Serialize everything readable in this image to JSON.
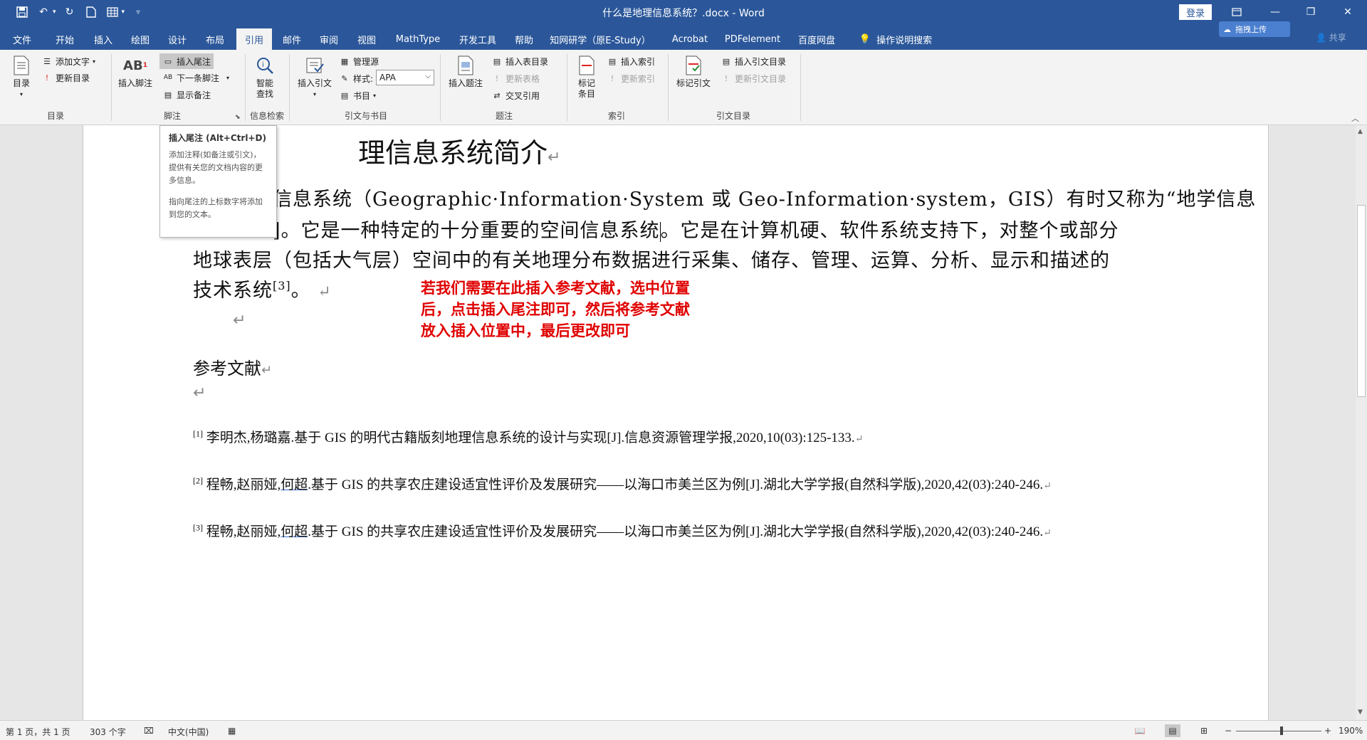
{
  "titlebar": {
    "title": "什么是地理信息系统？.docx  -  Word",
    "login": "登录",
    "icons": [
      "save-icon",
      "undo-icon",
      "redo-icon",
      "new-doc-icon",
      "table-icon",
      "customize-qat-icon"
    ]
  },
  "tabs": [
    "文件",
    "开始",
    "插入",
    "绘图",
    "设计",
    "布局",
    "引用",
    "邮件",
    "审阅",
    "视图",
    "MathType",
    "开发工具",
    "帮助",
    "知网研学（原E-Study）",
    "Acrobat",
    "PDFelement",
    "百度网盘",
    "操作说明搜索"
  ],
  "active_tab": "引用",
  "upload_label": "拖拽上传",
  "share_label": "共享",
  "ribbon": {
    "toc": {
      "big": "目录",
      "add_text": "添加文字",
      "update": "更新目录",
      "group": "目录"
    },
    "footnotes": {
      "insert_footnote": "插入脚注",
      "insert_endnote": "插入尾注",
      "next_footnote": "下一条脚注",
      "show_notes": "显示备注",
      "group": "脚注"
    },
    "research": {
      "smart_lookup_1": "智能",
      "smart_lookup_2": "查找",
      "group": "信息检索"
    },
    "citations": {
      "insert_citation": "插入引文",
      "manage_sources": "管理源",
      "style_label": "样式:",
      "style_value": "APA",
      "bibliography": "书目",
      "group": "引文与书目"
    },
    "captions": {
      "insert_caption": "插入题注",
      "insert_tof": "插入表目录",
      "update_table": "更新表格",
      "cross_ref": "交叉引用",
      "group": "题注"
    },
    "index": {
      "mark_entry_1": "标记",
      "mark_entry_2": "条目",
      "insert_index": "插入索引",
      "update_index": "更新索引",
      "group": "索引"
    },
    "toa": {
      "mark_citation": "标记引文",
      "insert_toa": "插入引文目录",
      "update_toa": "更新引文目录",
      "group": "引文目录"
    }
  },
  "tooltip": {
    "title": "插入尾注 (Alt+Ctrl+D)",
    "p1": "添加注释(如备注或引文)，提供有关您的文档内容的更多信息。",
    "p2": "指向尾注的上标数字将添加到您的文本。"
  },
  "document": {
    "title": "理信息系统简介",
    "line1": "信息系统（Geographic·Information·System 或 Geo-Information·system，GIS）有时又称为“地学信息",
    "line2a": "]。它是一种特定的十分重要的空间信息系统",
    "line2b": "。它是在计算机硬、软件系统支持下，对整个或部分",
    "line3": "地球表层（包括大气层）空间中的有关地理分布数据进行采集、储存、管理、运算、分析、显示和描述的",
    "line4": "技术系统",
    "line4_sup": "[3]",
    "line4_end": "。",
    "annotation_1": "若我们需要在此插入参考文献，选中位置",
    "annotation_2": "后，点击插入尾注即可，然后将参考文献",
    "annotation_3": "放入插入位置中，最后更改即可",
    "ref_heading": "参考文献",
    "refs": [
      {
        "num": "[1]",
        "pre": "李明杰,杨璐嘉.基于 GIS 的明代古籍版刻地理信息系统的设计与实现[J].信息资源管理学报,2020,10(03):125-133.",
        "ul": "",
        "post": ""
      },
      {
        "num": "[2]",
        "pre": "程畅,赵丽娅,",
        "ul": "何超",
        "post": ".基于 GIS 的共享农庄建设适宜性评价及发展研究——以海口市美兰区为例[J].湖北大学学报(自然科学版),2020,42(03):240-246."
      },
      {
        "num": "[3]",
        "pre": "程畅,赵丽娅,",
        "ul": "何超",
        "post": ".基于 GIS 的共享农庄建设适宜性评价及发展研究——以海口市美兰区为例[J].湖北大学学报(自然科学版),2020,42(03):240-246."
      }
    ]
  },
  "statusbar": {
    "page": "第 1 页，共 1 页",
    "words": "303 个字",
    "language": "中文(中国)",
    "zoom": "190%"
  }
}
